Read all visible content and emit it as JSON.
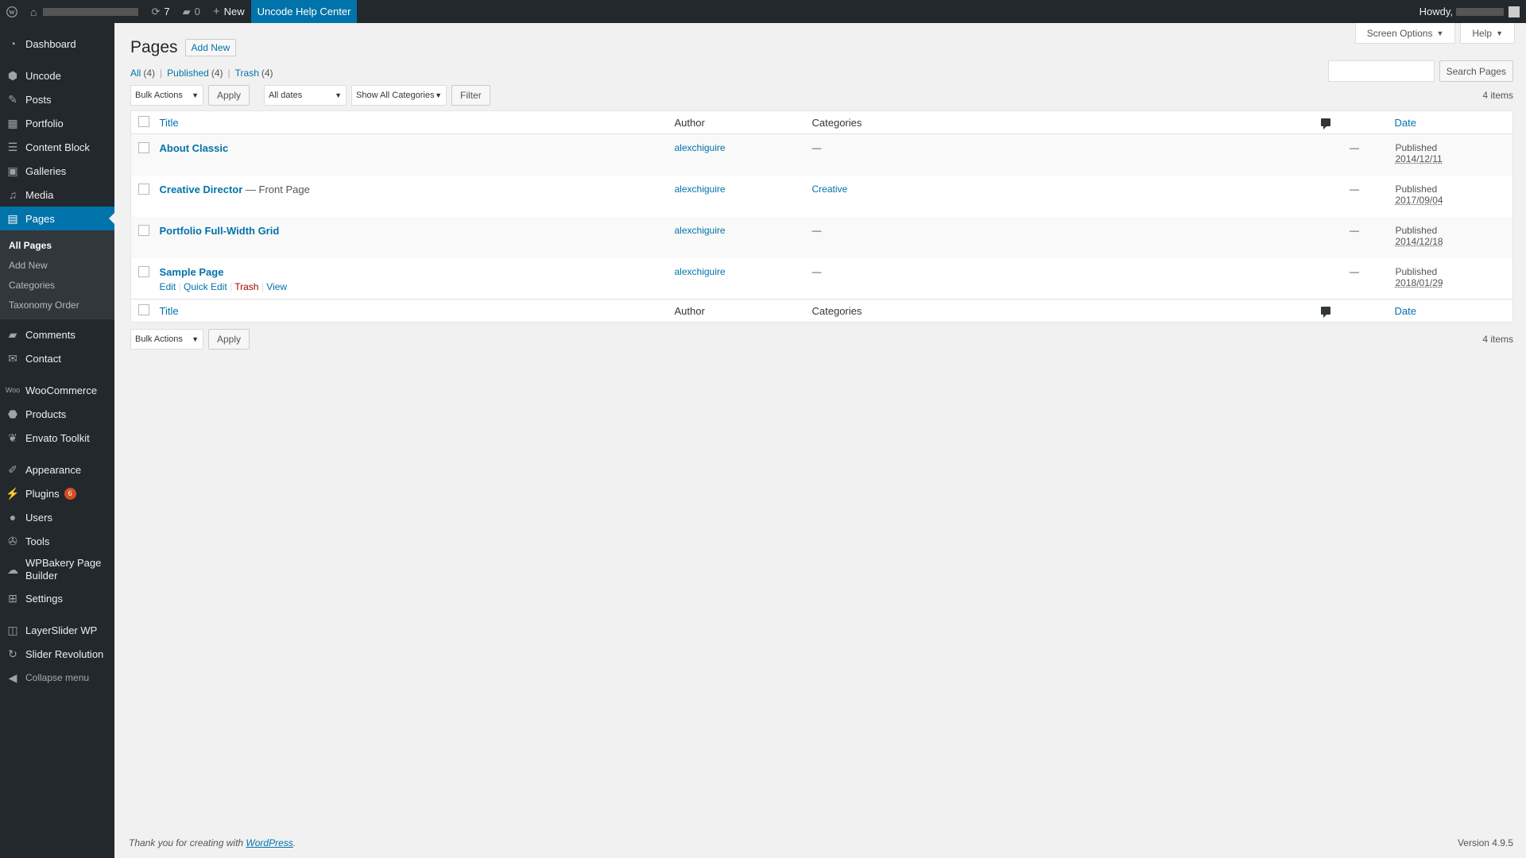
{
  "admin_bar": {
    "updates_count": "7",
    "comments_count": "0",
    "new_label": "New",
    "help_center_label": "Uncode Help Center",
    "howdy_label": "Howdy,"
  },
  "sidebar": {
    "items": [
      {
        "label": "Dashboard",
        "icon": "dashboard-icon"
      },
      {
        "label": "Uncode",
        "icon": "uncode-icon"
      },
      {
        "label": "Posts",
        "icon": "pin-icon"
      },
      {
        "label": "Portfolio",
        "icon": "portfolio-icon"
      },
      {
        "label": "Content Block",
        "icon": "content-block-icon"
      },
      {
        "label": "Galleries",
        "icon": "galleries-icon"
      },
      {
        "label": "Media",
        "icon": "media-icon"
      },
      {
        "label": "Pages",
        "icon": "pages-icon"
      },
      {
        "label": "Comments",
        "icon": "comments-icon"
      },
      {
        "label": "Contact",
        "icon": "mail-icon"
      },
      {
        "label": "WooCommerce",
        "icon": "woocommerce-icon"
      },
      {
        "label": "Products",
        "icon": "products-icon"
      },
      {
        "label": "Envato Toolkit",
        "icon": "envato-icon"
      },
      {
        "label": "Appearance",
        "icon": "brush-icon"
      },
      {
        "label": "Plugins",
        "icon": "plugin-icon",
        "badge": "6"
      },
      {
        "label": "Users",
        "icon": "users-icon"
      },
      {
        "label": "Tools",
        "icon": "tools-icon"
      },
      {
        "label": "WPBakery Page Builder",
        "icon": "wpbakery-icon"
      },
      {
        "label": "Settings",
        "icon": "settings-icon"
      },
      {
        "label": "LayerSlider WP",
        "icon": "layerslider-icon"
      },
      {
        "label": "Slider Revolution",
        "icon": "refresh-icon"
      },
      {
        "label": "Collapse menu",
        "icon": "collapse-icon"
      }
    ],
    "pages_submenu": [
      "All Pages",
      "Add New",
      "Categories",
      "Taxonomy Order"
    ]
  },
  "header": {
    "screen_options": "Screen Options",
    "help": "Help",
    "title": "Pages",
    "add_new": "Add New"
  },
  "filters": {
    "all": "All",
    "all_count": "(4)",
    "published": "Published",
    "published_count": "(4)",
    "trash": "Trash",
    "trash_count": "(4)"
  },
  "search": {
    "button": "Search Pages"
  },
  "tablenav": {
    "bulk_actions": "Bulk Actions",
    "apply": "Apply",
    "dates": "All dates",
    "categories": "Show All Categories",
    "filter": "Filter",
    "items": "4 items"
  },
  "columns": {
    "title": "Title",
    "author": "Author",
    "categories": "Categories",
    "date": "Date"
  },
  "rows": [
    {
      "title": "About Classic",
      "state": "",
      "author": "alexchiguire",
      "categories": "—",
      "comments": "—",
      "status": "Published",
      "date": "2014/12/11"
    },
    {
      "title": "Creative Director",
      "state": " — Front Page",
      "author": "alexchiguire",
      "categories": "Creative",
      "comments": "—",
      "status": "Published",
      "date": "2017/09/04"
    },
    {
      "title": "Portfolio Full-Width Grid",
      "state": "",
      "author": "alexchiguire",
      "categories": "—",
      "comments": "—",
      "status": "Published",
      "date": "2014/12/18"
    },
    {
      "title": "Sample Page",
      "state": "",
      "author": "alexchiguire",
      "categories": "—",
      "comments": "—",
      "status": "Published",
      "date": "2018/01/29"
    }
  ],
  "row_actions": {
    "edit": "Edit",
    "quick_edit": "Quick Edit",
    "trash": "Trash",
    "view": "View"
  },
  "footer": {
    "thanks_prefix": "Thank you for creating with ",
    "wordpress": "WordPress",
    "thanks_suffix": ".",
    "version": "Version 4.9.5"
  }
}
